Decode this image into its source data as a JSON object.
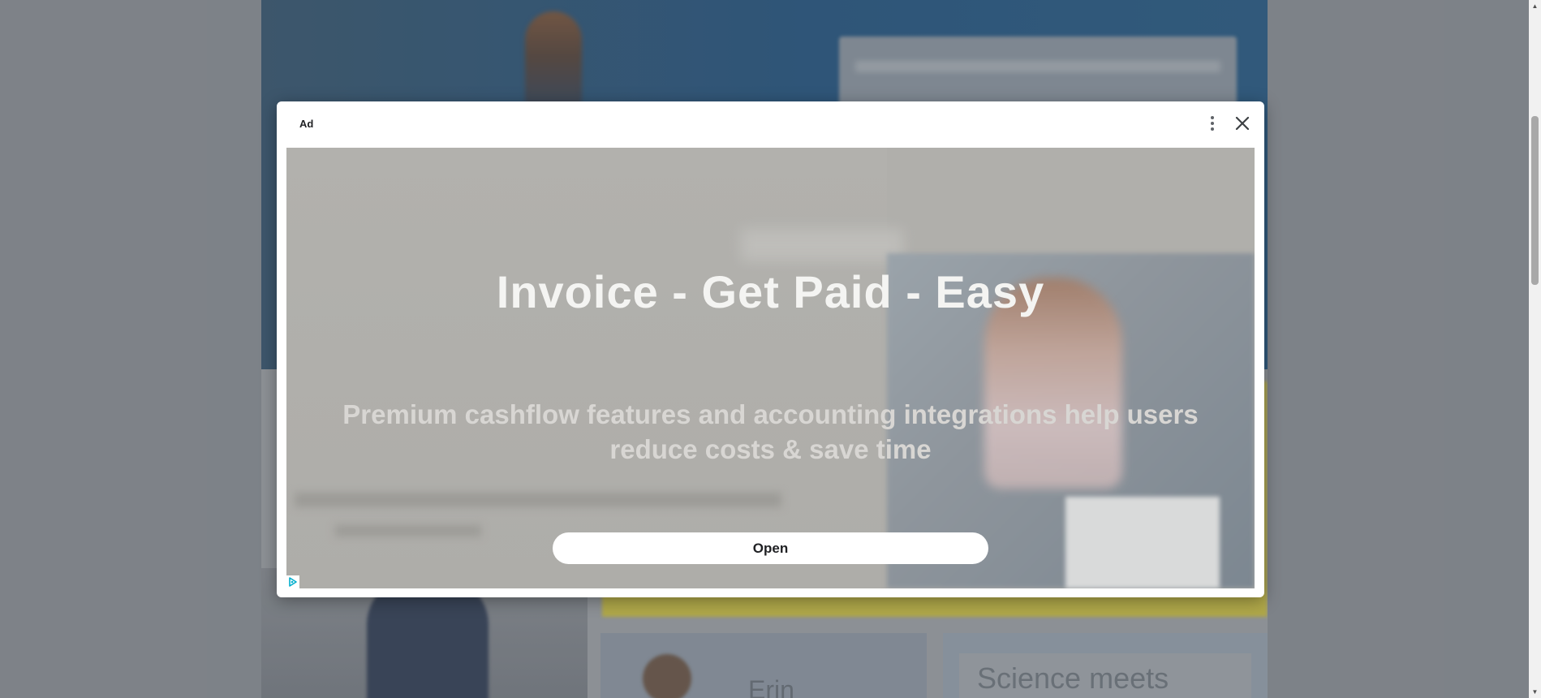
{
  "background": {
    "person_card_name": "Erin",
    "science_card_title": "Science meets"
  },
  "ad": {
    "label": "Ad",
    "headline": "Invoice - Get Paid - Easy",
    "subheadline": "Premium cashflow features and accounting integrations help users reduce costs & save time",
    "cta_label": "Open",
    "more_icon": "more-vert-icon",
    "close_icon": "close-icon",
    "adchoices_icon": "adchoices-icon"
  },
  "scrollbar": {
    "up_glyph": "▲",
    "down_glyph": "▼"
  }
}
